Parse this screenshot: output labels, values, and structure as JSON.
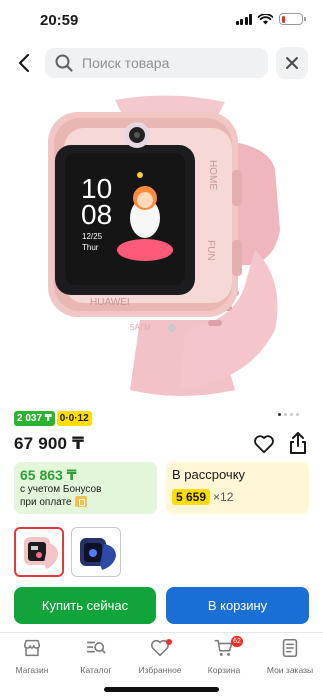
{
  "status": {
    "time": "20:59",
    "battery_level": 0.2
  },
  "search": {
    "placeholder": "Поиск товара"
  },
  "gallery": {
    "total": 4,
    "current": 1
  },
  "product": {
    "badges": [
      {
        "text": "2 037 ₸",
        "color": "#2db334"
      },
      {
        "text": "0·0·12",
        "color": "#ffdd00"
      }
    ],
    "price": "67 900 ₸",
    "bonus": {
      "amount": "65 863 ₸",
      "line1": "с учетом Бонусов",
      "line2": "при оплате"
    },
    "installment": {
      "title": "В рассрочку",
      "amount": "5 659",
      "multiplier": "×12"
    }
  },
  "actions": {
    "buy_label": "Купить сейчас",
    "cart_label": "В корзину"
  },
  "colors": {
    "buy": "#12a33a",
    "cart": "#1a6fd6",
    "accent_red": "#e23a3a"
  },
  "tabs": [
    {
      "label": "Магазин",
      "icon": "shop-icon"
    },
    {
      "label": "Каталог",
      "icon": "catalog-icon"
    },
    {
      "label": "Избранное",
      "icon": "heart-icon",
      "dot": true
    },
    {
      "label": "Корзина",
      "icon": "cart-icon",
      "count": "62"
    },
    {
      "label": "Мои заказы",
      "icon": "orders-icon"
    }
  ]
}
